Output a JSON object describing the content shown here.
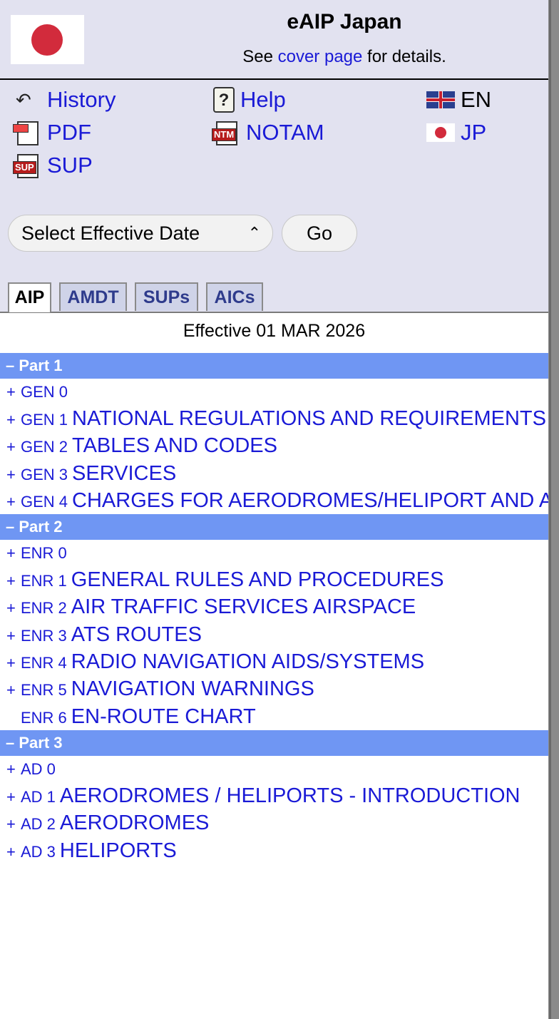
{
  "header": {
    "title": "eAIP Japan",
    "cover_prefix": "See ",
    "cover_link": "cover page",
    "cover_suffix": " for details."
  },
  "nav": {
    "history": "History",
    "help": "Help",
    "lang_en": "EN",
    "pdf": "PDF",
    "notam": "NOTAM",
    "lang_jp": "JP",
    "sup": "SUP",
    "notam_tag": "NTM",
    "sup_tag": "SUP"
  },
  "date_select": {
    "selected": "Select Effective Date",
    "chevron": "⌃⌄"
  },
  "go_label": "Go",
  "tabs": [
    "AIP",
    "AMDT",
    "SUPs",
    "AICs"
  ],
  "effective_text": "Effective 01 MAR 2026",
  "toc": {
    "parts": [
      {
        "label": "– Part 1",
        "items": [
          {
            "pm": "+",
            "code": "GEN 0",
            "title": ""
          },
          {
            "pm": "+",
            "code": "GEN 1",
            "title": "NATIONAL REGULATIONS AND REQUIREMENTS"
          },
          {
            "pm": "+",
            "code": "GEN 2",
            "title": "TABLES AND CODES"
          },
          {
            "pm": "+",
            "code": "GEN 3",
            "title": "SERVICES"
          },
          {
            "pm": "+",
            "code": "GEN 4",
            "title": "CHARGES FOR AERODROMES/HELIPORT AND AIR NAVIGATION SERVICES"
          }
        ]
      },
      {
        "label": "– Part 2",
        "items": [
          {
            "pm": "+",
            "code": "ENR 0",
            "title": ""
          },
          {
            "pm": "+",
            "code": "ENR 1",
            "title": "GENERAL RULES AND PROCEDURES"
          },
          {
            "pm": "+",
            "code": "ENR 2",
            "title": "AIR TRAFFIC SERVICES AIRSPACE"
          },
          {
            "pm": "+",
            "code": "ENR 3",
            "title": "ATS ROUTES"
          },
          {
            "pm": "+",
            "code": "ENR 4",
            "title": "RADIO NAVIGATION AIDS/SYSTEMS"
          },
          {
            "pm": "+",
            "code": "ENR 5",
            "title": "NAVIGATION WARNINGS"
          },
          {
            "pm": "",
            "code": "ENR 6",
            "title": "EN-ROUTE CHART"
          }
        ]
      },
      {
        "label": "– Part 3",
        "items": [
          {
            "pm": "+",
            "code": "AD 0",
            "title": ""
          },
          {
            "pm": "+",
            "code": "AD 1",
            "title": "AERODROMES / HELIPORTS - INTRODUCTION"
          },
          {
            "pm": "+",
            "code": "AD 2",
            "title": "AERODROMES"
          },
          {
            "pm": "+",
            "code": "AD 3",
            "title": "HELIPORTS"
          }
        ]
      }
    ]
  }
}
